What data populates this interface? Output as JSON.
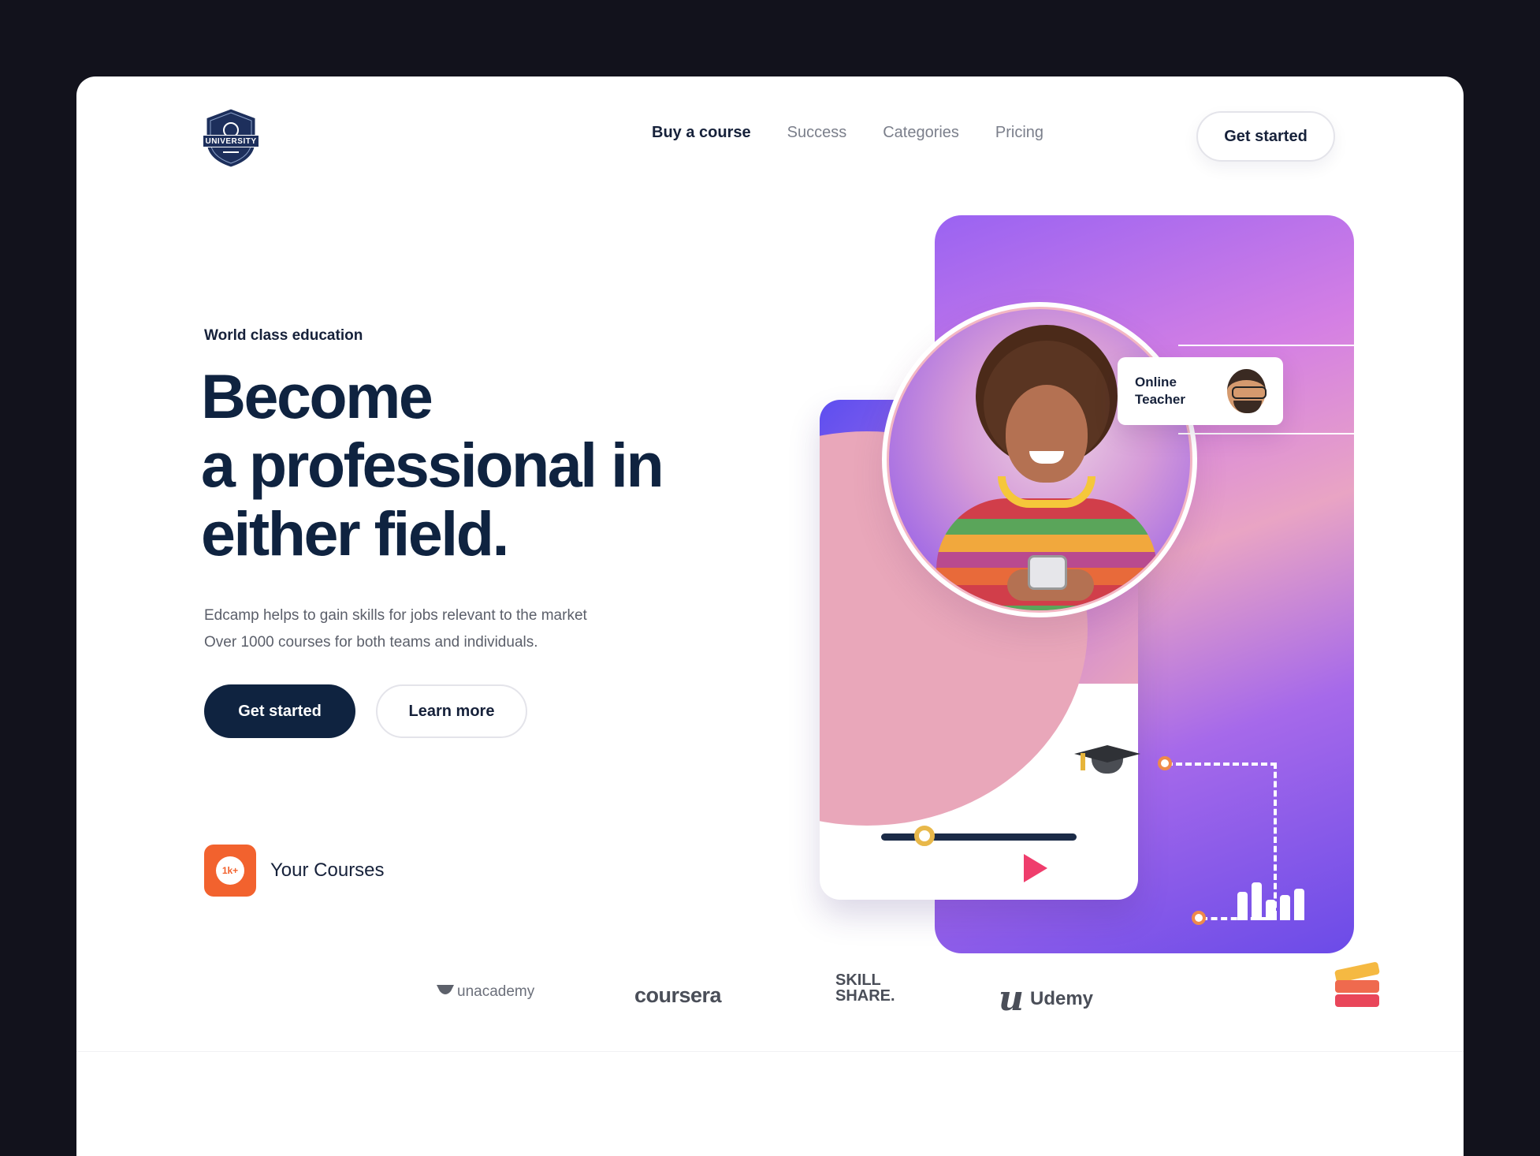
{
  "brand": {
    "logo_text": "UNIVERSITY"
  },
  "nav": {
    "items": [
      {
        "label": "Buy a course",
        "active": true
      },
      {
        "label": "Success",
        "active": false
      },
      {
        "label": "Categories",
        "active": false
      },
      {
        "label": "Pricing",
        "active": false
      }
    ],
    "cta_label": "Get started"
  },
  "hero": {
    "eyebrow": "World class education",
    "headline": [
      "Become",
      "a professional in",
      "either field."
    ],
    "description": [
      "Edcamp helps to gain skills for jobs relevant to the market",
      "Over 1000 courses for both teams and individuals."
    ],
    "primary_button": "Get started",
    "secondary_button": "Learn more",
    "courses_badge": "1k+",
    "courses_label": "Your Courses"
  },
  "teacher_card": {
    "label": [
      "Online",
      "Teacher"
    ]
  },
  "partners": {
    "unacademy": "unacademy",
    "coursera": "coursera",
    "skillshare": [
      "SKILL",
      "SHARE."
    ],
    "udemy": "Udemy"
  },
  "colors": {
    "navy": "#0f2340",
    "accent_orange": "#f2622e",
    "purple": "#9a63f2",
    "pink": "#e9a7ba"
  },
  "icons": [
    "shield-logo-icon",
    "graduation-cap-icon",
    "play-icon",
    "bar-chart-icon",
    "books-icon",
    "teacher-avatar-icon"
  ]
}
